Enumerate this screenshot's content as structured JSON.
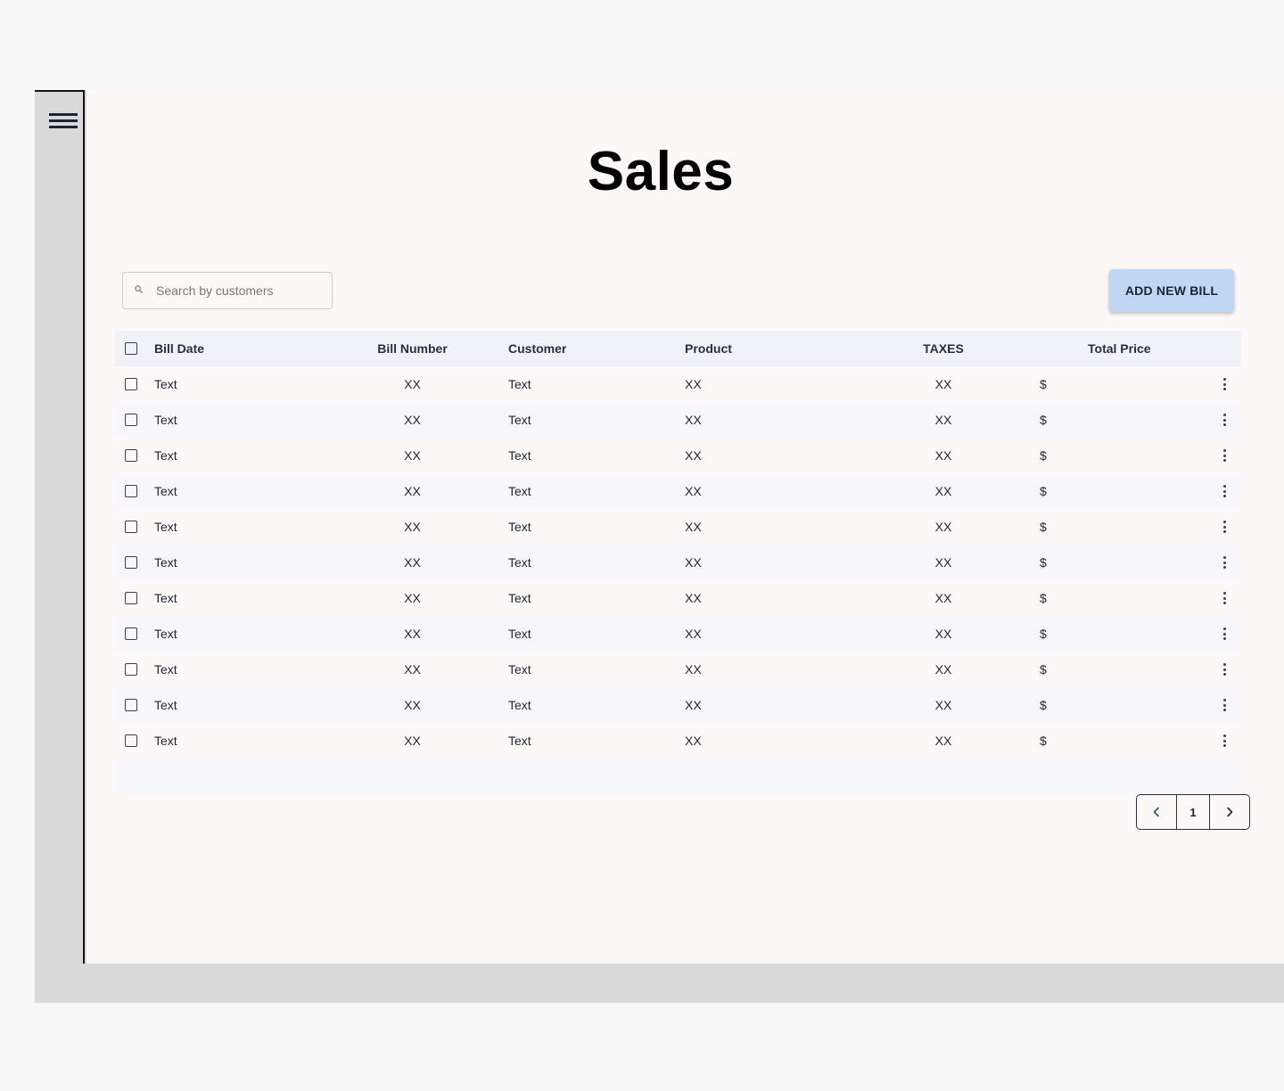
{
  "page": {
    "title": "Sales"
  },
  "search": {
    "placeholder": "Search by customers",
    "value": ""
  },
  "actions": {
    "add_new_bill_label": "ADD NEW BILL"
  },
  "icons": {
    "menu": "hamburger-menu-icon",
    "search": "search-icon",
    "row_actions": "more-vertical-icon",
    "prev": "chevron-left-icon",
    "next": "chevron-right-icon"
  },
  "colors": {
    "accent_button": "#bfd7f3",
    "table_header_bg": "#f1f2f8",
    "content_bg": "#fdf8f8",
    "sidebar_bg": "#d9d9d9"
  },
  "table": {
    "columns": [
      "Bill Date",
      "Bill Number",
      "Customer",
      "Product",
      "TAXES",
      "Total Price"
    ],
    "rows": [
      {
        "date": "Text",
        "number": "XX",
        "customer": "Text",
        "product": "XX",
        "taxes": "XX",
        "total": "$"
      },
      {
        "date": "Text",
        "number": "XX",
        "customer": "Text",
        "product": "XX",
        "taxes": "XX",
        "total": "$"
      },
      {
        "date": "Text",
        "number": "XX",
        "customer": "Text",
        "product": "XX",
        "taxes": "XX",
        "total": "$"
      },
      {
        "date": "Text",
        "number": "XX",
        "customer": "Text",
        "product": "XX",
        "taxes": "XX",
        "total": "$"
      },
      {
        "date": "Text",
        "number": "XX",
        "customer": "Text",
        "product": "XX",
        "taxes": "XX",
        "total": "$"
      },
      {
        "date": "Text",
        "number": "XX",
        "customer": "Text",
        "product": "XX",
        "taxes": "XX",
        "total": "$"
      },
      {
        "date": "Text",
        "number": "XX",
        "customer": "Text",
        "product": "XX",
        "taxes": "XX",
        "total": "$"
      },
      {
        "date": "Text",
        "number": "XX",
        "customer": "Text",
        "product": "XX",
        "taxes": "XX",
        "total": "$"
      },
      {
        "date": "Text",
        "number": "XX",
        "customer": "Text",
        "product": "XX",
        "taxes": "XX",
        "total": "$"
      },
      {
        "date": "Text",
        "number": "XX",
        "customer": "Text",
        "product": "XX",
        "taxes": "XX",
        "total": "$"
      },
      {
        "date": "Text",
        "number": "XX",
        "customer": "Text",
        "product": "XX",
        "taxes": "XX",
        "total": "$"
      }
    ]
  },
  "pagination": {
    "current_page": "1"
  }
}
